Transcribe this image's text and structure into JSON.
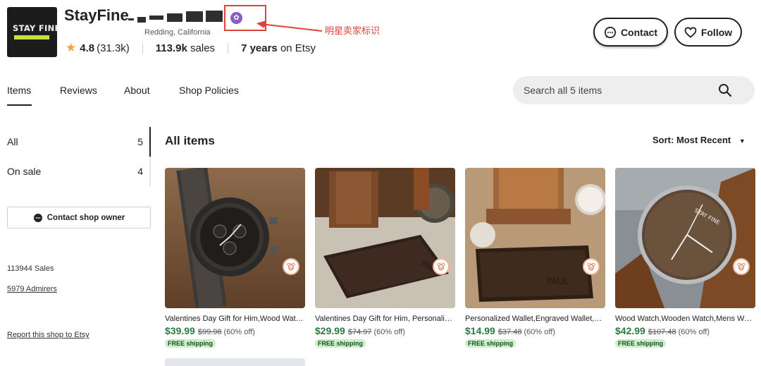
{
  "shop": {
    "logo_text": "STAY FINE",
    "name": "StayFine",
    "location": "Redding, California",
    "rating": "4.8",
    "rating_count": "(31.3k)",
    "sales_value": "113.9k",
    "sales_label": "sales",
    "years_value": "7 years",
    "years_label": "on Etsy",
    "star_seller_annotation": "明星卖家标识"
  },
  "actions": {
    "contact_label": "Contact",
    "follow_label": "Follow"
  },
  "tabs": [
    {
      "label": "Items"
    },
    {
      "label": "Reviews"
    },
    {
      "label": "About"
    },
    {
      "label": "Shop Policies"
    }
  ],
  "search": {
    "placeholder": "Search all 5 items"
  },
  "sidebar": {
    "categories": [
      {
        "label": "All",
        "count": "5"
      },
      {
        "label": "On sale",
        "count": "4"
      }
    ],
    "contact_owner_label": "Contact shop owner",
    "sales_text": "113944 Sales",
    "admirers_text": "5979 Admirers",
    "report_text": "Report this shop to Etsy"
  },
  "main": {
    "section_title": "All items",
    "sort_label": "Sort:",
    "sort_value": "Most Recent"
  },
  "items": [
    {
      "title": "Valentines Day Gift for Him,Wood Watch,Mens Watch",
      "price": "$39.99",
      "original_price": "$99.98",
      "discount": "(60% off)",
      "shipping": "FREE shipping"
    },
    {
      "title": "Valentines Day Gift for Him, Personalized Wallet",
      "price": "$29.99",
      "original_price": "$74.97",
      "discount": "(60% off)",
      "shipping": "FREE shipping"
    },
    {
      "title": "Personalized Wallet,Engraved Wallet,Mens Wallet",
      "price": "$14.99",
      "original_price": "$37.48",
      "discount": "(60% off)",
      "shipping": "FREE shipping"
    },
    {
      "title": "Wood Watch,Wooden Watch,Mens Watch,Gift for Him",
      "price": "$42.99",
      "original_price": "$107.48",
      "discount": "(60% off)",
      "shipping": "FREE shipping"
    }
  ],
  "colors": {
    "accent_text": "#222222",
    "price_green": "#2b7a3d",
    "star_seller_purple": "#8b5cc7",
    "annotation_red": "#e0423a",
    "rating_star": "#f1a33b"
  }
}
